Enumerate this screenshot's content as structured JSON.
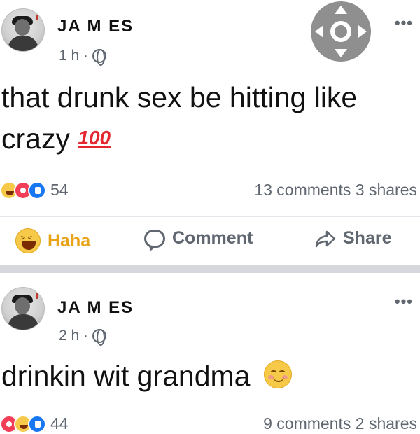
{
  "posts": [
    {
      "author": "JA M ES",
      "time": "1 h ·",
      "text": "that drunk sex be hitting like crazy",
      "emoji": "100",
      "reaction_count": "54",
      "comments_shares": "13 comments  3 shares",
      "more": "•••",
      "actions": {
        "haha": "Haha",
        "comment": "Comment",
        "share": "Share"
      }
    },
    {
      "author": "JA M ES",
      "time": "2 h ·",
      "text": "drinkin wit grandma",
      "reaction_count": "44",
      "comments_shares": "9 comments  2 shares",
      "more": "•••"
    }
  ],
  "icons": {
    "avatar": "avatar-photo",
    "globe": "globe-icon",
    "dpad": "dpad-icon",
    "haha": "haha-icon",
    "comment": "comment-icon",
    "share": "share-icon"
  },
  "colors": {
    "like_blue": "#1877f2",
    "love_red": "#f33e58",
    "haha_yellow": "#f7c948",
    "text_gray": "#606770"
  }
}
